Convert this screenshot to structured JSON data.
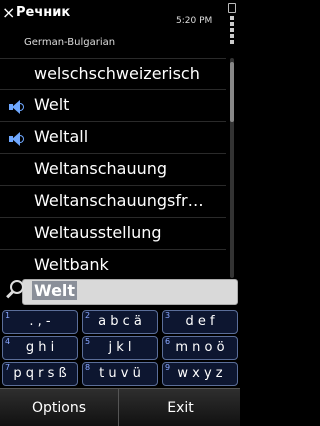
{
  "header": {
    "close_glyph": "×",
    "title": "Речник",
    "subtitle": "German-Bulgarian",
    "time": "5:20 PM"
  },
  "list": {
    "items": [
      {
        "label": "welschschweizerisch",
        "audio": false
      },
      {
        "label": "Welt",
        "audio": true
      },
      {
        "label": "Weltall",
        "audio": true
      },
      {
        "label": "Weltanschauung",
        "audio": false
      },
      {
        "label": "Weltanschauungsfr…",
        "audio": false
      },
      {
        "label": "Weltausstellung",
        "audio": false
      },
      {
        "label": "Weltbank",
        "audio": false
      }
    ]
  },
  "search": {
    "value": "Welt"
  },
  "keypad": {
    "keys": [
      {
        "num": "1",
        "label": ". , -"
      },
      {
        "num": "2",
        "label": "a b c ä"
      },
      {
        "num": "3",
        "label": "d e f"
      },
      {
        "num": "4",
        "label": "g h i"
      },
      {
        "num": "5",
        "label": "j k l"
      },
      {
        "num": "6",
        "label": "m n o ö"
      },
      {
        "num": "7",
        "label": "p q r s ß"
      },
      {
        "num": "8",
        "label": "t u v ü"
      },
      {
        "num": "9",
        "label": "w x y z"
      }
    ]
  },
  "softkeys": {
    "left": "Options",
    "right": "Exit"
  },
  "colors": {
    "accent": "#6fa8ff",
    "key_bg": "#0d1630",
    "key_border": "#5b6e99"
  }
}
